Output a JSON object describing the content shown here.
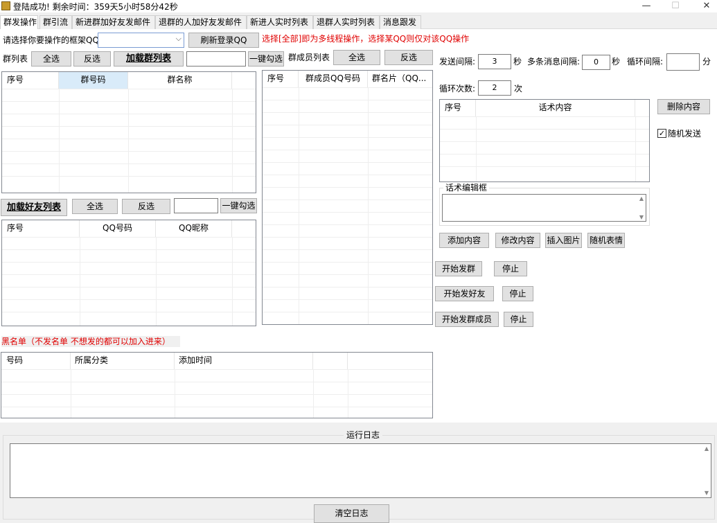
{
  "window": {
    "title": "登陆成功! 剩余时间：359天5小时58分42秒",
    "min_icon": "—",
    "max_icon": "☐",
    "close_icon": "✕",
    "app_icon": "app-icon",
    "app_icon_color": "#c89a2b"
  },
  "tabs": [
    "群发操作",
    "群引流",
    "新进群加好友发邮件",
    "退群的人加好友发邮件",
    "新进人实时列表",
    "退群人实时列表",
    "消息跟发"
  ],
  "active_tab": 0,
  "frame_qq": {
    "label": "请选择你要操作的框架QQ",
    "selected": "",
    "refresh_button": "刷新登录QQ",
    "hint": "选择[全部]即为多线程操作，选择某QQ则仅对该QQ操作"
  },
  "group_list": {
    "label": "群列表",
    "select_all": "全选",
    "invert": "反选",
    "load": "加载群列表",
    "search_value": "",
    "one_click_check": "一键勾选",
    "columns": [
      "序号",
      "群号码",
      "群名称"
    ]
  },
  "member_list": {
    "label": "群成员列表",
    "select_all": "全选",
    "invert": "反选",
    "columns": [
      "序号",
      "群成员QQ号码",
      "群名片（QQ..."
    ]
  },
  "friend_list": {
    "load": "加载好友列表",
    "select_all": "全选",
    "invert": "反选",
    "search_value": "",
    "one_click_check": "一键勾选",
    "columns": [
      "序号",
      "QQ号码",
      "QQ昵称"
    ]
  },
  "blacklist": {
    "label": "黑名单（不发名单 不想发的都可以加入进来）",
    "columns": [
      "号码",
      "所属分类",
      "添加时间"
    ]
  },
  "settings": {
    "send_interval_label": "发送间隔:",
    "send_interval": "3",
    "send_interval_unit": "秒",
    "multi_msg_label": "多条消息间隔:",
    "multi_msg": "0",
    "multi_msg_unit": "秒",
    "loop_interval_label": "循环间隔:",
    "loop_interval": "",
    "loop_interval_unit": "分",
    "loop_count_label": "循环次数:",
    "loop_count": "2",
    "loop_count_unit": "次"
  },
  "script_table": {
    "columns": [
      "序号",
      "话术内容"
    ],
    "delete_button": "删除内容",
    "random_send_label": "随机发送",
    "random_send_checked": true,
    "editor_label": "话术编辑框",
    "editor_value": ""
  },
  "script_buttons": [
    "添加内容",
    "修改内容",
    "插入图片",
    "随机表情"
  ],
  "actions": {
    "start_group": "开始发群",
    "stop1": "停止",
    "start_friend": "开始发好友",
    "stop2": "停止",
    "start_member": "开始发群成员",
    "stop3": "停止"
  },
  "log": {
    "label": "运行日志",
    "value": "",
    "clear_button": "清空日志"
  },
  "colors": {
    "hint_red": "#e00000",
    "selected_header": "#d9ebf9"
  }
}
